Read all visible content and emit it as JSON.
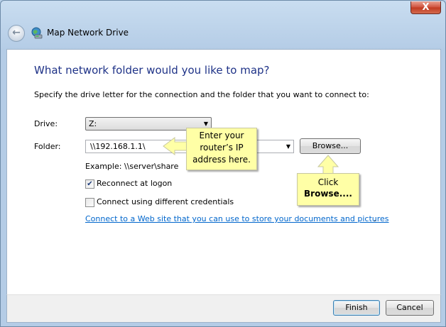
{
  "window": {
    "title": "Map Network Drive",
    "close_label": "X"
  },
  "content": {
    "heading": "What network folder would you like to map?",
    "description": "Specify the drive letter for the connection and the folder that you want to connect to:",
    "drive_label": "Drive:",
    "drive_value": "Z:",
    "folder_label": "Folder:",
    "folder_value": "\\\\192.168.1.1\\",
    "browse_label": "Browse...",
    "example_text": "Example: \\\\server\\share",
    "reconnect_label": "Reconnect at logon",
    "reconnect_checked": true,
    "credentials_label": "Connect using different credentials",
    "credentials_checked": false,
    "link_text": "Connect to a Web site that you can use to store your documents and pictures",
    "link_trailing": "."
  },
  "callouts": {
    "ip": {
      "line1": "Enter your",
      "line2": "router’s IP",
      "line3": "address here."
    },
    "browse": {
      "line1": "Click",
      "line2": "Browse...."
    }
  },
  "footer": {
    "finish_label": "Finish",
    "cancel_label": "Cancel"
  },
  "colors": {
    "heading": "#1e3287",
    "link": "#0066cc",
    "callout_bg": "#ffffa6",
    "window_frame": "#b4cce6"
  }
}
